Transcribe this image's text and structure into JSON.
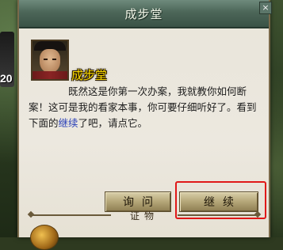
{
  "window": {
    "title": "成步堂",
    "close_symbol": "×"
  },
  "background": {
    "side_number": "20"
  },
  "dialog": {
    "speaker": "成步堂",
    "message_parts": {
      "before": "既然这是你第一次办案，我就教你如何断案！这可是我的看家本事，你可要仔细听好了。看到下面的",
      "keyword": "继续",
      "after": "了吧，请点它。"
    }
  },
  "buttons": {
    "inquire": "询问",
    "continue": "继续"
  },
  "section": {
    "evidence_label": "证物"
  },
  "colors": {
    "speaker_name": "#f6d800",
    "keyword": "#2a40b8",
    "highlight_box": "#e01818",
    "title_bar": "#4c6658"
  },
  "icons": {
    "close": "close-icon",
    "portrait": "character-portrait",
    "item": "gold-orb-icon"
  }
}
